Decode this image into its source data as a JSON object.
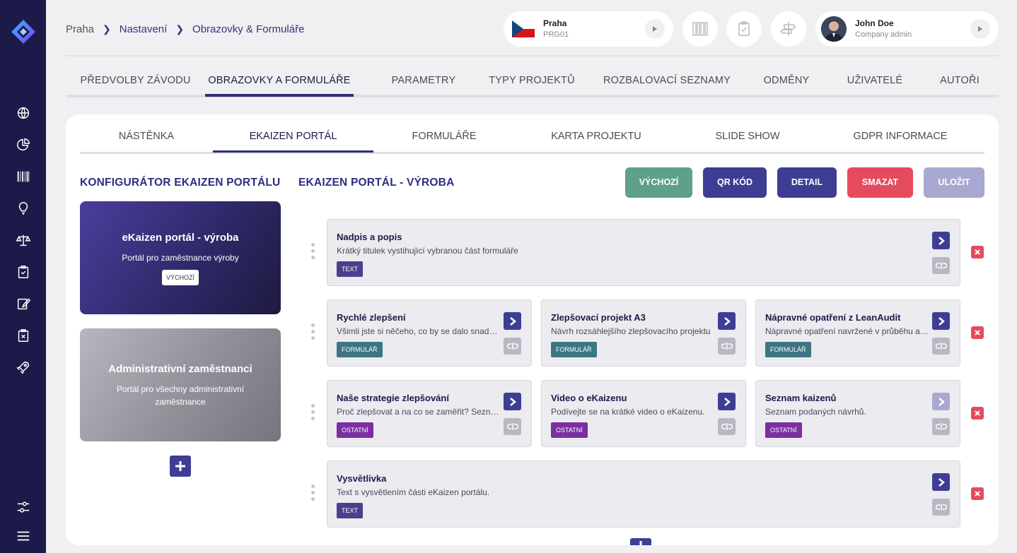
{
  "breadcrumb": {
    "items": [
      "Praha",
      "Nastavení",
      "Obrazovky & Formuláře"
    ]
  },
  "location": {
    "name": "Praha",
    "code": "PRG01"
  },
  "user": {
    "name": "John Doe",
    "role": "Company admin"
  },
  "main_tabs": [
    "PŘEDVOLBY ZÁVODU",
    "OBRAZOVKY A FORMULÁŘE",
    "PARAMETRY",
    "TYPY PROJEKTŮ",
    "ROZBALOVACÍ SEZNAMY",
    "ODMĚNY",
    "UŽIVATELÉ",
    "AUTOŘI"
  ],
  "sub_tabs": [
    "NÁSTĚNKA",
    "EKAIZEN PORTÁL",
    "FORMULÁŘE",
    "KARTA PROJEKTU",
    "SLIDE SHOW",
    "GDPR INFORMACE"
  ],
  "configurator": {
    "title": "KONFIGURÁTOR EKAIZEN PORTÁLU",
    "portals": [
      {
        "title": "eKaizen portál - výroba",
        "desc": "Portál pro zaměstnance výroby",
        "badge": "VÝCHOZÍ"
      },
      {
        "title": "Administrativní zaměstnanci",
        "desc": "Portál pro všechny administrativní zaměstnance"
      }
    ]
  },
  "editor": {
    "title": "EKAIZEN PORTÁL - VÝROBA",
    "buttons": {
      "default": "VÝCHOZÍ",
      "qr": "QR KÓD",
      "detail": "DETAIL",
      "delete": "SMAZAT",
      "save": "ULOŽIT"
    },
    "rows": [
      [
        {
          "title": "Nadpis a popis",
          "desc": "Krátký titulek vystihující vybranou část formuláře",
          "tag": "TEXT"
        }
      ],
      [
        {
          "title": "Rychlé zlepšení",
          "desc": "Všimli jste si něčeho, co by se dalo snadno zlepšit?",
          "tag": "FORMULÁŘ"
        },
        {
          "title": "Zlepšovací projekt A3",
          "desc": "Návrh rozsáhlejšího zlepšovacího projektu",
          "tag": "FORMULÁŘ"
        },
        {
          "title": "Nápravné opatření z LeanAudit",
          "desc": "Nápravné opatření navržené v průběhu auditu",
          "tag": "FORMULÁŘ"
        }
      ],
      [
        {
          "title": "Naše strategie zlepšování",
          "desc": "Proč zlepšovat a na co se zaměřit? Seznamte se",
          "tag": "OSTATNÍ"
        },
        {
          "title": "Video o eKaizenu",
          "desc": "Podívejte se na krátké video o eKaizenu.",
          "tag": "OSTATNÍ"
        },
        {
          "title": "Seznam kaizenů",
          "desc": "Seznam podaných návrhů.",
          "tag": "OSTATNÍ"
        }
      ],
      [
        {
          "title": "Vysvětlivka",
          "desc": "Text s vysvětlením části eKaizen portálu.",
          "tag": "TEXT"
        }
      ]
    ]
  },
  "colors": {
    "rail": "#1c1a48",
    "accent": "#2c2f7e",
    "btn_default": "#5fa08a",
    "btn_primary": "#3d3e93",
    "btn_delete": "#e54b5e",
    "btn_save_disabled": "#a8a8d0",
    "tag_text": "#4e3d8c",
    "tag_form": "#3e7583",
    "tag_other": "#7b2fa0"
  },
  "icons": [
    "app-logo-icon",
    "globe-icon",
    "pie-chart-icon",
    "barcode-icon",
    "lightbulb-icon",
    "scales-icon",
    "clipboard-check-icon",
    "edit-note-icon",
    "clipboard-x-icon",
    "rocket-icon",
    "sliders-icon",
    "menu-icon"
  ]
}
